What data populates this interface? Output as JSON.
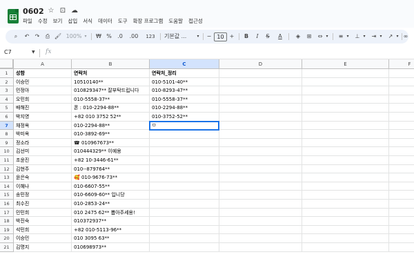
{
  "titlebar": {
    "title": "0602",
    "icons": [
      "star-icon",
      "folder-move-icon",
      "cloud-status-icon"
    ],
    "menu": [
      "파일",
      "수정",
      "보기",
      "삽입",
      "서식",
      "데이터",
      "도구",
      "확장 프로그램",
      "도움말",
      "접근성"
    ]
  },
  "toolbar": {
    "zoom": "100%",
    "currency": "₩",
    "percent": "%",
    "decrease_decimal": ".0",
    "increase_decimal": ".00",
    "number_format": "123",
    "font": "기본값 ...",
    "font_size": "10",
    "bold": "B",
    "text_color_label": "A"
  },
  "formula_bar": {
    "name_box": "C7",
    "fx_label": "fx",
    "content": ""
  },
  "grid": {
    "columns": [
      "A",
      "B",
      "C",
      "D",
      "E",
      "F"
    ],
    "active_column": "C",
    "active_row": 7,
    "active_cell_value": "ㅁ",
    "rows": [
      {
        "n": "1",
        "a": "성함",
        "b": "연락처",
        "c": "연락처_정리"
      },
      {
        "n": "2",
        "a": "이승민",
        "b": "10510140**",
        "c": "010-5101-40**"
      },
      {
        "n": "3",
        "a": "민정아",
        "b": "010829347** 잘부탁드립니다",
        "c": "010-8293-47**"
      },
      {
        "n": "4",
        "a": "오민희",
        "b": "010-5558-37**",
        "c": "010-5558-37**"
      },
      {
        "n": "5",
        "a": "배해진",
        "b": "폰 : 010-2294-88**",
        "c": "010-2294-88**"
      },
      {
        "n": "6",
        "a": "박지영",
        "b": "+82 010 3752 52**",
        "c": "010-3752-52**"
      },
      {
        "n": "7",
        "a": "채정옥",
        "b": "010-2294-88**",
        "c": ""
      },
      {
        "n": "8",
        "a": "박미옥",
        "b": "010-3892-69**",
        "c": ""
      },
      {
        "n": "9",
        "a": "정소라",
        "b": "☎ 010967673**",
        "c": ""
      },
      {
        "n": "10",
        "a": "김선미",
        "b": "010444329** 이예용",
        "c": ""
      },
      {
        "n": "11",
        "a": "조윤진",
        "b": "+82 10-3446-61**",
        "c": ""
      },
      {
        "n": "12",
        "a": "김현주",
        "b": "010--879764**",
        "c": ""
      },
      {
        "n": "13",
        "a": "윤은숙",
        "b": "🥰 010-9676-73**",
        "c": ""
      },
      {
        "n": "14",
        "a": "이혜나",
        "b": "010-6607-55**",
        "c": ""
      },
      {
        "n": "15",
        "a": "송민정",
        "b": "010-6609-60** 입니당",
        "c": ""
      },
      {
        "n": "16",
        "a": "최수진",
        "b": "010-2853-24**",
        "c": ""
      },
      {
        "n": "17",
        "a": "민민희",
        "b": "010 2475 62** 뽑아주세용!",
        "c": ""
      },
      {
        "n": "18",
        "a": "박진숙",
        "b": "010372937**",
        "c": ""
      },
      {
        "n": "19",
        "a": "석민희",
        "b": "+82 010-5113-96**",
        "c": ""
      },
      {
        "n": "20",
        "a": "이승민",
        "b": "010 3095 63**",
        "c": ""
      },
      {
        "n": "21",
        "a": "김명지",
        "b": "010698973**",
        "c": ""
      }
    ]
  }
}
